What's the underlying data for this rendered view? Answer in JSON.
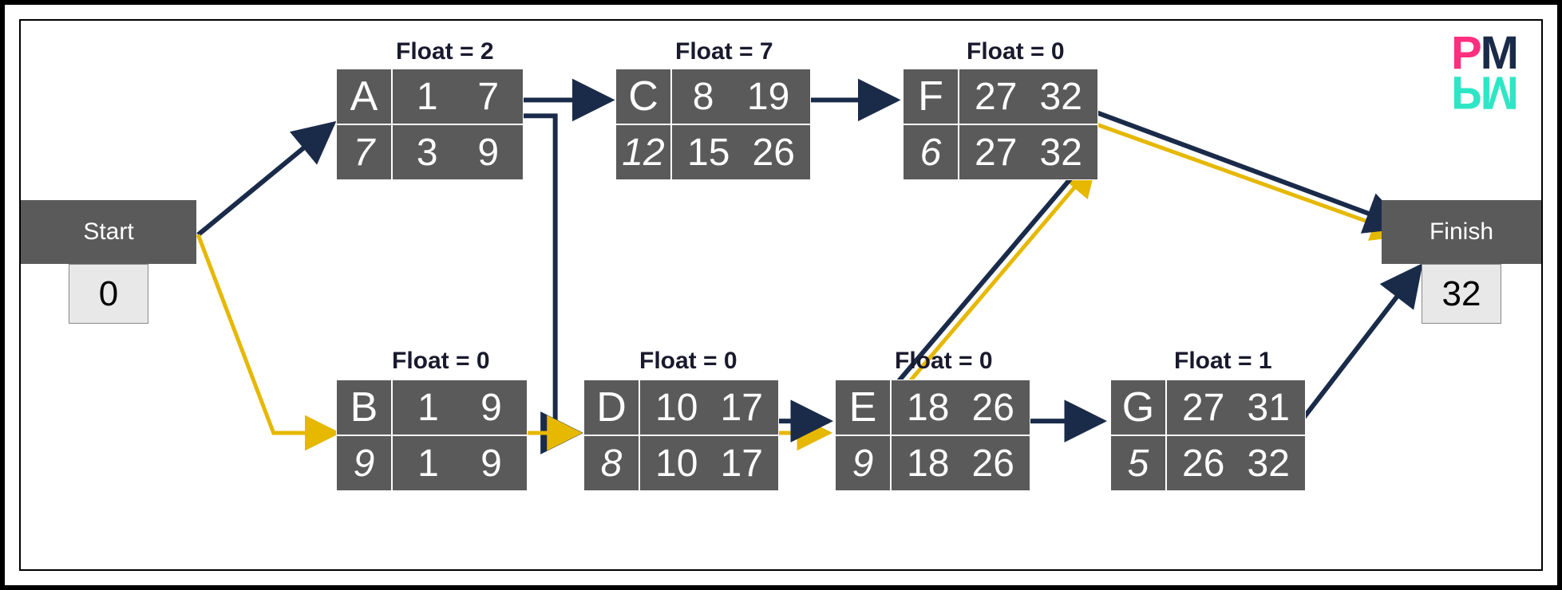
{
  "chart_data": {
    "type": "network-diagram",
    "title": "Critical Path Method Network Diagram",
    "start": {
      "label": "Start",
      "value": 0
    },
    "finish": {
      "label": "Finish",
      "value": 32
    },
    "activities": [
      {
        "id": "A",
        "float": 2,
        "duration": 7,
        "es": 1,
        "ef": 7,
        "ls": 3,
        "lf": 9
      },
      {
        "id": "B",
        "float": 0,
        "duration": 9,
        "es": 1,
        "ef": 9,
        "ls": 1,
        "lf": 9
      },
      {
        "id": "C",
        "float": 7,
        "duration": 12,
        "es": 8,
        "ef": 19,
        "ls": 15,
        "lf": 26
      },
      {
        "id": "D",
        "float": 0,
        "duration": 8,
        "es": 10,
        "ef": 17,
        "ls": 10,
        "lf": 17
      },
      {
        "id": "E",
        "float": 0,
        "duration": 9,
        "es": 18,
        "ef": 26,
        "ls": 18,
        "lf": 26
      },
      {
        "id": "F",
        "float": 0,
        "duration": 6,
        "es": 27,
        "ef": 32,
        "ls": 27,
        "lf": 32
      },
      {
        "id": "G",
        "float": 1,
        "duration": 5,
        "es": 27,
        "ef": 31,
        "ls": 26,
        "lf": 32
      }
    ],
    "float_prefix": "Float = ",
    "arrows": [
      {
        "from": "Start",
        "to": "A",
        "color": "navy"
      },
      {
        "from": "Start",
        "to": "B",
        "color": "gold"
      },
      {
        "from": "A",
        "to": "C",
        "color": "navy"
      },
      {
        "from": "A",
        "to": "D",
        "color": "navy"
      },
      {
        "from": "B",
        "to": "D",
        "color": "gold"
      },
      {
        "from": "C",
        "to": "F",
        "color": "navy"
      },
      {
        "from": "D",
        "to": "E",
        "color": "gold"
      },
      {
        "from": "E",
        "to": "F",
        "color": "gold"
      },
      {
        "from": "E",
        "to": "G",
        "color": "navy"
      },
      {
        "from": "F",
        "to": "Finish",
        "color": "gold"
      },
      {
        "from": "G",
        "to": "Finish",
        "color": "navy"
      }
    ],
    "critical_path": [
      "Start",
      "B",
      "D",
      "E",
      "F",
      "Finish"
    ]
  },
  "logo": {
    "top": "PM",
    "bottom": "PM"
  }
}
